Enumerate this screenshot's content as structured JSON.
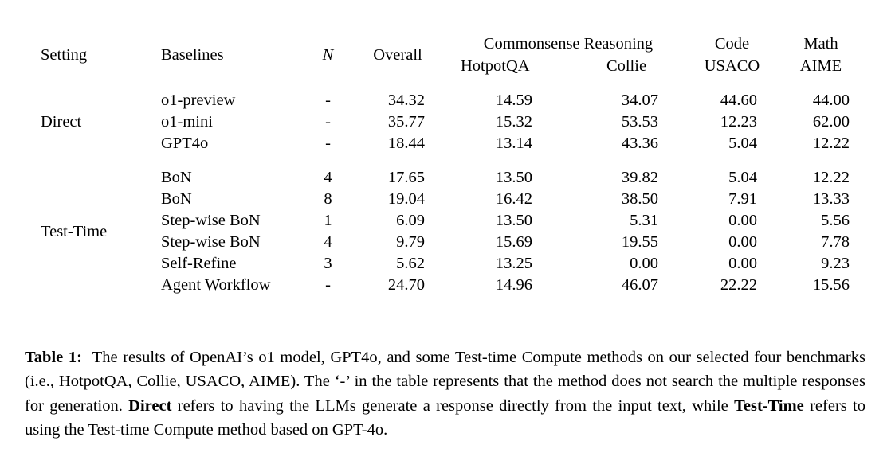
{
  "table": {
    "headers": {
      "setting": "Setting",
      "baselines": "Baselines",
      "n": "N",
      "overall": "Overall",
      "group_commonsense": "Commonsense Reasoning",
      "group_code": "Code",
      "group_math": "Math",
      "sub_hotpotqa": "HotpotQA",
      "sub_collie": "Collie",
      "sub_usaco": "USACO",
      "sub_aime": "AIME"
    },
    "sections": [
      {
        "label": "Direct",
        "rows": [
          {
            "baseline": "o1-preview",
            "n": "-",
            "overall": "34.32",
            "hotpotqa": "14.59",
            "collie": "34.07",
            "usaco": "44.60",
            "aime": "44.00",
            "bold": {
              "overall": false,
              "hotpotqa": false,
              "collie": false,
              "usaco": true,
              "aime": false
            }
          },
          {
            "baseline": "o1-mini",
            "n": "-",
            "overall": "35.77",
            "hotpotqa": "15.32",
            "collie": "53.53",
            "usaco": "12.23",
            "aime": "62.00",
            "bold": {
              "overall": true,
              "hotpotqa": false,
              "collie": true,
              "usaco": false,
              "aime": true
            }
          },
          {
            "baseline": "GPT4o",
            "n": "-",
            "overall": "18.44",
            "hotpotqa": "13.14",
            "collie": "43.36",
            "usaco": "5.04",
            "aime": "12.22",
            "bold": {
              "overall": false,
              "hotpotqa": false,
              "collie": false,
              "usaco": false,
              "aime": false
            }
          }
        ]
      },
      {
        "label": "Test-Time",
        "rows": [
          {
            "baseline": "BoN",
            "n": "4",
            "overall": "17.65",
            "hotpotqa": "13.50",
            "collie": "39.82",
            "usaco": "5.04",
            "aime": "12.22",
            "bold": {
              "overall": false,
              "hotpotqa": false,
              "collie": false,
              "usaco": false,
              "aime": false
            }
          },
          {
            "baseline": "BoN",
            "n": "8",
            "overall": "19.04",
            "hotpotqa": "16.42",
            "collie": "38.50",
            "usaco": "7.91",
            "aime": "13.33",
            "bold": {
              "overall": false,
              "hotpotqa": true,
              "collie": false,
              "usaco": false,
              "aime": false
            }
          },
          {
            "baseline": "Step-wise BoN",
            "n": "1",
            "overall": "6.09",
            "hotpotqa": "13.50",
            "collie": "5.31",
            "usaco": "0.00",
            "aime": "5.56",
            "bold": {
              "overall": false,
              "hotpotqa": false,
              "collie": false,
              "usaco": false,
              "aime": false
            }
          },
          {
            "baseline": "Step-wise BoN",
            "n": "4",
            "overall": "9.79",
            "hotpotqa": "15.69",
            "collie": "19.55",
            "usaco": "0.00",
            "aime": "7.78",
            "bold": {
              "overall": false,
              "hotpotqa": false,
              "collie": false,
              "usaco": false,
              "aime": false
            }
          },
          {
            "baseline": "Self-Refine",
            "n": "3",
            "overall": "5.62",
            "hotpotqa": "13.25",
            "collie": "0.00",
            "usaco": "0.00",
            "aime": "9.23",
            "bold": {
              "overall": false,
              "hotpotqa": false,
              "collie": false,
              "usaco": false,
              "aime": false
            }
          },
          {
            "baseline": "Agent Workflow",
            "n": "-",
            "overall": "24.70",
            "hotpotqa": "14.96",
            "collie": "46.07",
            "usaco": "22.22",
            "aime": "15.56",
            "bold": {
              "overall": false,
              "hotpotqa": false,
              "collie": false,
              "usaco": false,
              "aime": false
            }
          }
        ]
      }
    ]
  },
  "caption": {
    "label": "Table 1:",
    "part1": "The results of OpenAI’s o1 model, GPT4o, and some Test-time Compute methods on our selected four benchmarks (i.e., HotpotQA, Collie, USACO, AIME). The ‘-’ in the table represents that the method does not search the multiple responses for generation. ",
    "bold1": "Direct",
    "part2": " refers to having the LLMs generate a response directly from the input text, while ",
    "bold2": "Test-Time",
    "part3": " refers to using the Test-time Compute method based on GPT-4o."
  }
}
